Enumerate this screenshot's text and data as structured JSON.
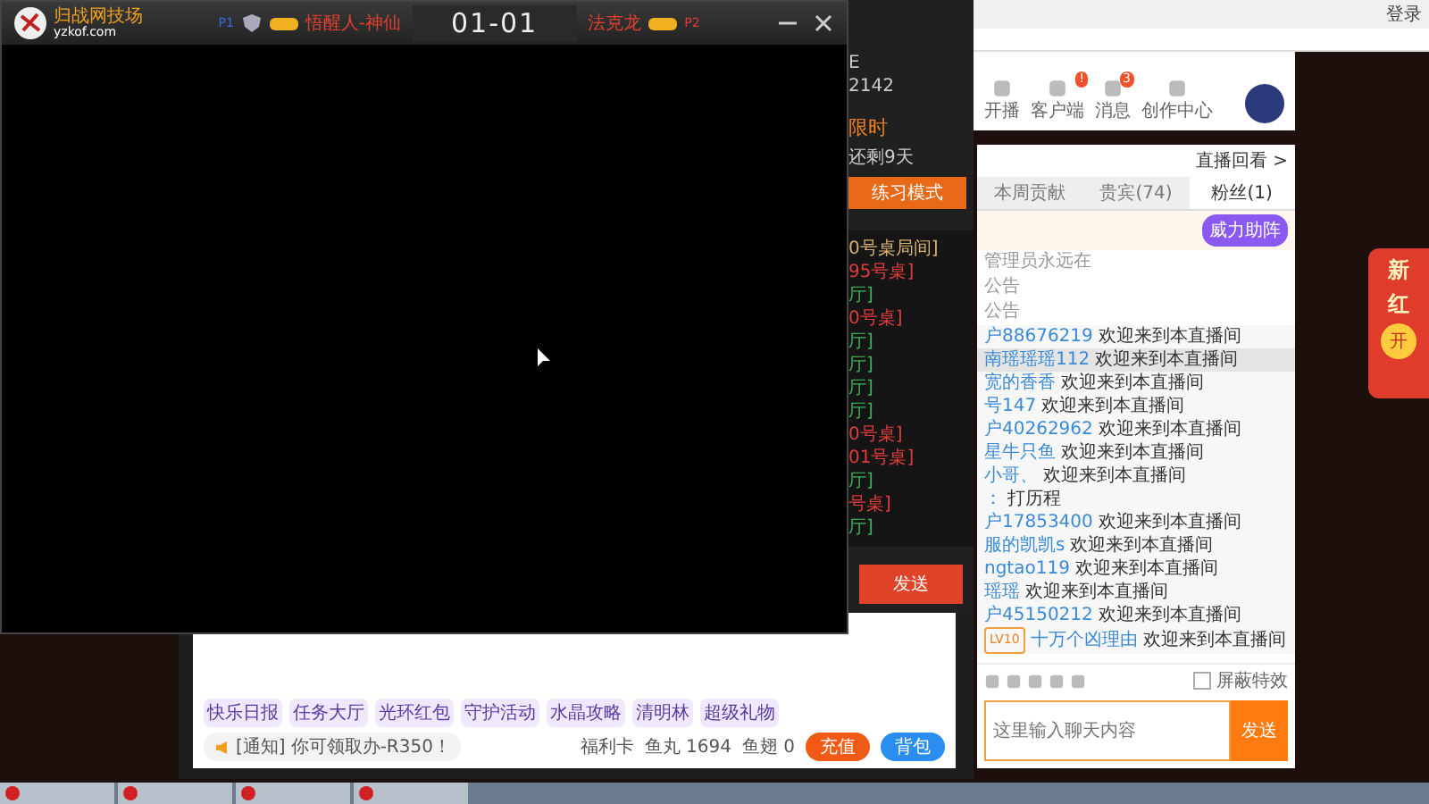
{
  "game_window": {
    "brand": "归战网技场",
    "site": "yzkof.com",
    "p1_tag": "P1",
    "p1_name": "悟醒人-神仙",
    "score": "01-01",
    "p2_name": "法克龙",
    "p2_tag": "P2"
  },
  "lobby": {
    "info_lines": [
      "E",
      "2142"
    ],
    "event_title": "限时",
    "event_countdown": "还剩9天",
    "mode_button": "练习模式",
    "rooms": [
      {
        "text": "0号桌局间]",
        "color": "#d8b070"
      },
      {
        "text": "95号桌]",
        "color": "#e03c3c"
      },
      {
        "text": "厅]",
        "color": "#3cb05a"
      },
      {
        "text": "0号桌]",
        "color": "#e03c3c"
      },
      {
        "text": "厅]",
        "color": "#3cb05a"
      },
      {
        "text": "厅]",
        "color": "#3cb05a"
      },
      {
        "text": "厅]",
        "color": "#3cb05a"
      },
      {
        "text": "厅]",
        "color": "#3cb05a"
      },
      {
        "text": "0号桌]",
        "color": "#e03c3c"
      },
      {
        "text": "01号桌]",
        "color": "#e03c3c"
      },
      {
        "text": "厅]",
        "color": "#3cb05a"
      },
      {
        "text": "号桌]",
        "color": "#e03c3c"
      },
      {
        "text": "厅]",
        "color": "#3cb05a"
      }
    ],
    "send_button": "发送",
    "features": [
      "快乐日报",
      "任务大厅",
      "光环红包",
      "守护活动",
      "水晶攻略",
      "清明林",
      "超级礼物"
    ],
    "notice_tag": "[通知]",
    "notice_text": "你可领取办-R350！",
    "welfare": "福利卡",
    "fish_balls": "鱼丸 1694",
    "fish_fins": "鱼翅 0",
    "recharge_button": "充值",
    "bag_button": "背包"
  },
  "browser": {
    "login": "登录",
    "nav": [
      {
        "label": "开播"
      },
      {
        "label": "客户端",
        "badge": "!"
      },
      {
        "label": "消息",
        "badge": "3"
      },
      {
        "label": "创作中心"
      }
    ]
  },
  "chat": {
    "replay_link": "直播回看 >",
    "tabs": [
      {
        "label": "本周贡献",
        "selected": false
      },
      {
        "label": "贵宾(74)",
        "selected": false
      },
      {
        "label": "粉丝(1)",
        "selected": true
      }
    ],
    "boost_button": "威力助阵",
    "system_lines": [
      "管理员永远在",
      "公告",
      "公告"
    ],
    "messages": [
      {
        "user": "户88676219",
        "text": "欢迎来到本直播间",
        "highlighted": false
      },
      {
        "user": "南瑶瑶瑶112",
        "text": "欢迎来到本直播间",
        "highlighted": true
      },
      {
        "user": "宽的香香",
        "text": "欢迎来到本直播间",
        "highlighted": false
      },
      {
        "user": "号147",
        "text": "欢迎来到本直播间",
        "highlighted": false
      },
      {
        "user": "户40262962",
        "text": "欢迎来到本直播间",
        "highlighted": false
      },
      {
        "user": "星牛只鱼",
        "text": "欢迎来到本直播间",
        "highlighted": false
      },
      {
        "user": "小哥、",
        "text": "欢迎来到本直播间",
        "highlighted": false
      },
      {
        "user": "：",
        "text": "打历程",
        "highlighted": false
      },
      {
        "user": "户17853400",
        "text": "欢迎来到本直播间",
        "highlighted": false
      },
      {
        "user": "服的凯凯s",
        "text": "欢迎来到本直播间",
        "highlighted": false
      },
      {
        "user": "ngtao119",
        "text": "欢迎来到本直播间",
        "highlighted": false
      },
      {
        "user": "瑶瑶",
        "text": "欢迎来到本直播间",
        "highlighted": false
      },
      {
        "user": "户45150212",
        "text": "欢迎来到本直播间",
        "highlighted": false
      },
      {
        "user": "十万个凶理由",
        "text": "欢迎来到本直播间",
        "highlighted": false,
        "level": "LV10"
      }
    ],
    "effects_toggle": {
      "label": "屏蔽特效",
      "checked": false
    },
    "input_placeholder": "这里输入聊天内容",
    "send_button": "发送"
  },
  "promo": {
    "title_lines": [
      "新",
      "红"
    ],
    "button": "开"
  }
}
